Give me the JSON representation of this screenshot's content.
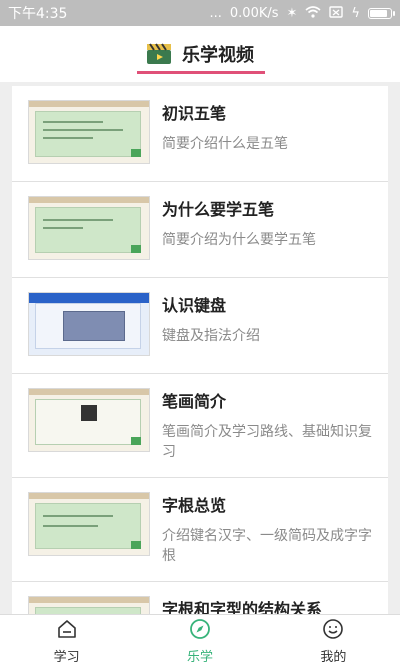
{
  "status": {
    "time": "下午4:35",
    "dots": "...",
    "speed": "0.00K/s",
    "battery_level": 0.85
  },
  "header": {
    "title": "乐学视频",
    "accent_color": "#e05078"
  },
  "items": [
    {
      "title": "初识五笔",
      "desc": "简要介绍什么是五笔"
    },
    {
      "title": "为什么要学五笔",
      "desc": "简要介绍为什么要学五笔"
    },
    {
      "title": "认识键盘",
      "desc": "键盘及指法介绍"
    },
    {
      "title": "笔画简介",
      "desc": "笔画简介及学习路线、基础知识复习"
    },
    {
      "title": "字根总览",
      "desc": "介绍键名汉字、一级简码及成字字根"
    },
    {
      "title": "字根和字型的结构关系",
      "desc": ""
    }
  ],
  "nav": {
    "items": [
      {
        "label": "学习",
        "icon": "home-icon"
      },
      {
        "label": "乐学",
        "icon": "compass-icon"
      },
      {
        "label": "我的",
        "icon": "smiley-icon"
      }
    ],
    "active_color": "#37b37a"
  }
}
